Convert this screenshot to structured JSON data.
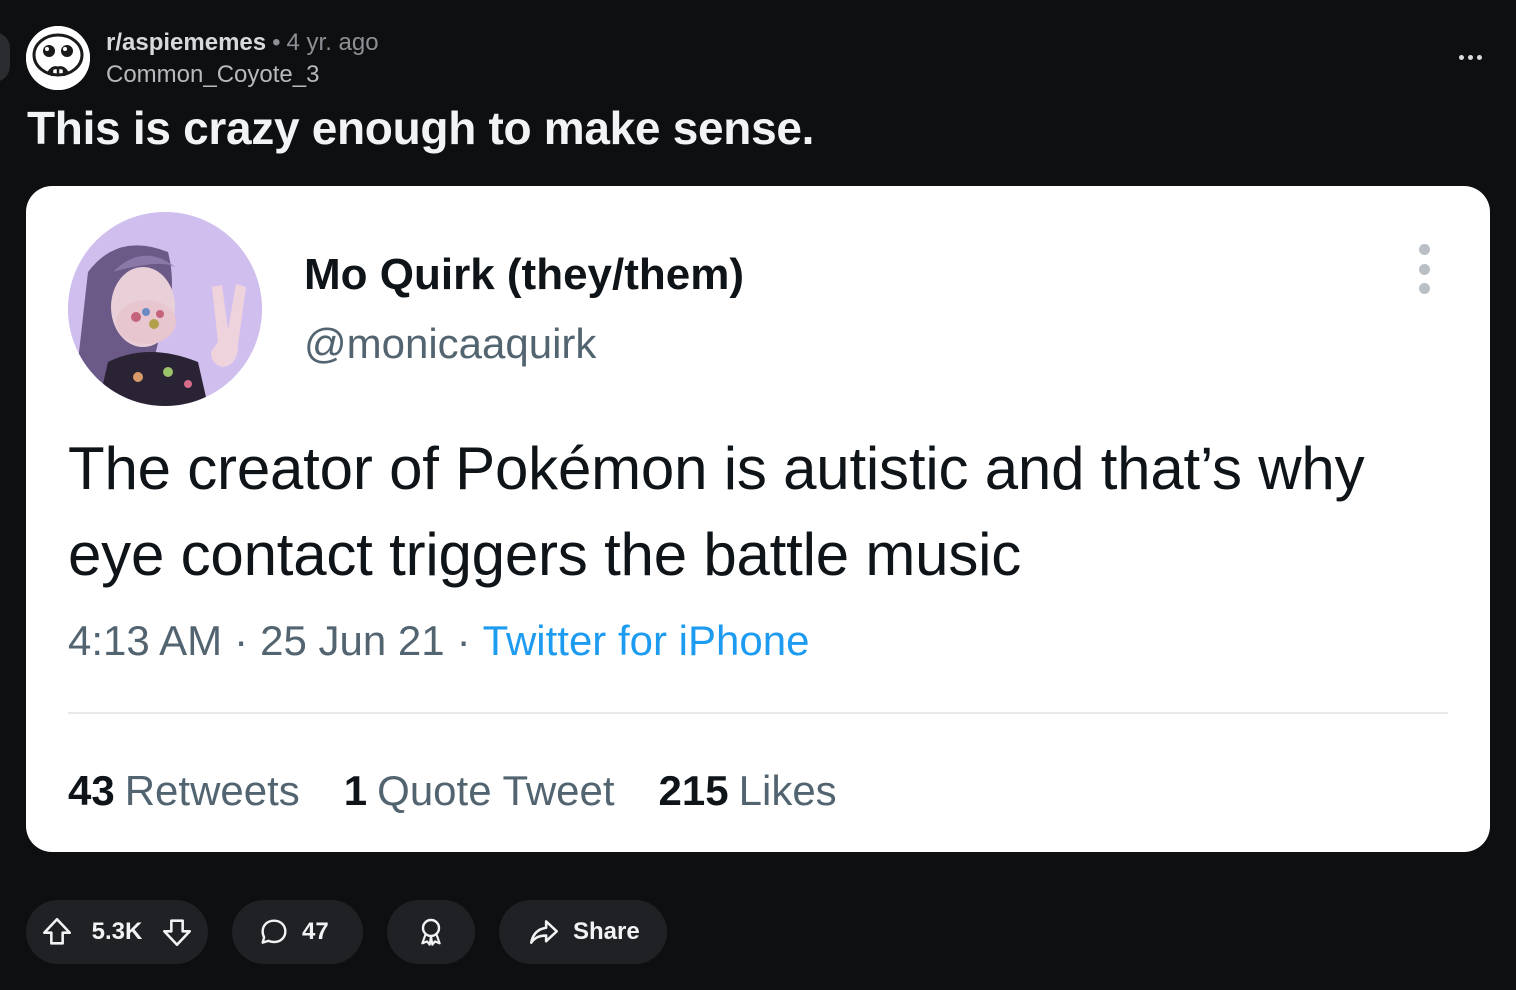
{
  "post": {
    "subreddit": "r/aspiememes",
    "separator": "•",
    "age": "4 yr. ago",
    "author": "Common_Coyote_3",
    "title": "This is crazy enough to make sense."
  },
  "tweet": {
    "display_name": "Mo Quirk (they/them)",
    "handle": "@monicaaquirk",
    "text": "The creator of Pokémon is autistic and that’s why eye contact triggers the battle music",
    "time": "4:13 AM",
    "date": "25 Jun 21",
    "sep": "·",
    "source": "Twitter for iPhone",
    "stats": [
      {
        "count": "43",
        "label": "Retweets"
      },
      {
        "count": "1",
        "label": "Quote Tweet"
      },
      {
        "count": "215",
        "label": "Likes"
      }
    ]
  },
  "actions": {
    "score": "5.3K",
    "comments": "47",
    "share_label": "Share"
  },
  "icons": {
    "upvote": "arrow-up-icon",
    "downvote": "arrow-down-icon",
    "comment": "speech-bubble-icon",
    "award": "award-icon",
    "share": "share-arrow-icon",
    "more": "ellipsis-icon"
  },
  "colors": {
    "background": "#0e0f11",
    "pill": "#1f2125",
    "tweet_card": "#ffffff",
    "twitter_blue": "#1d9bf0",
    "tweet_gray": "#536471"
  }
}
